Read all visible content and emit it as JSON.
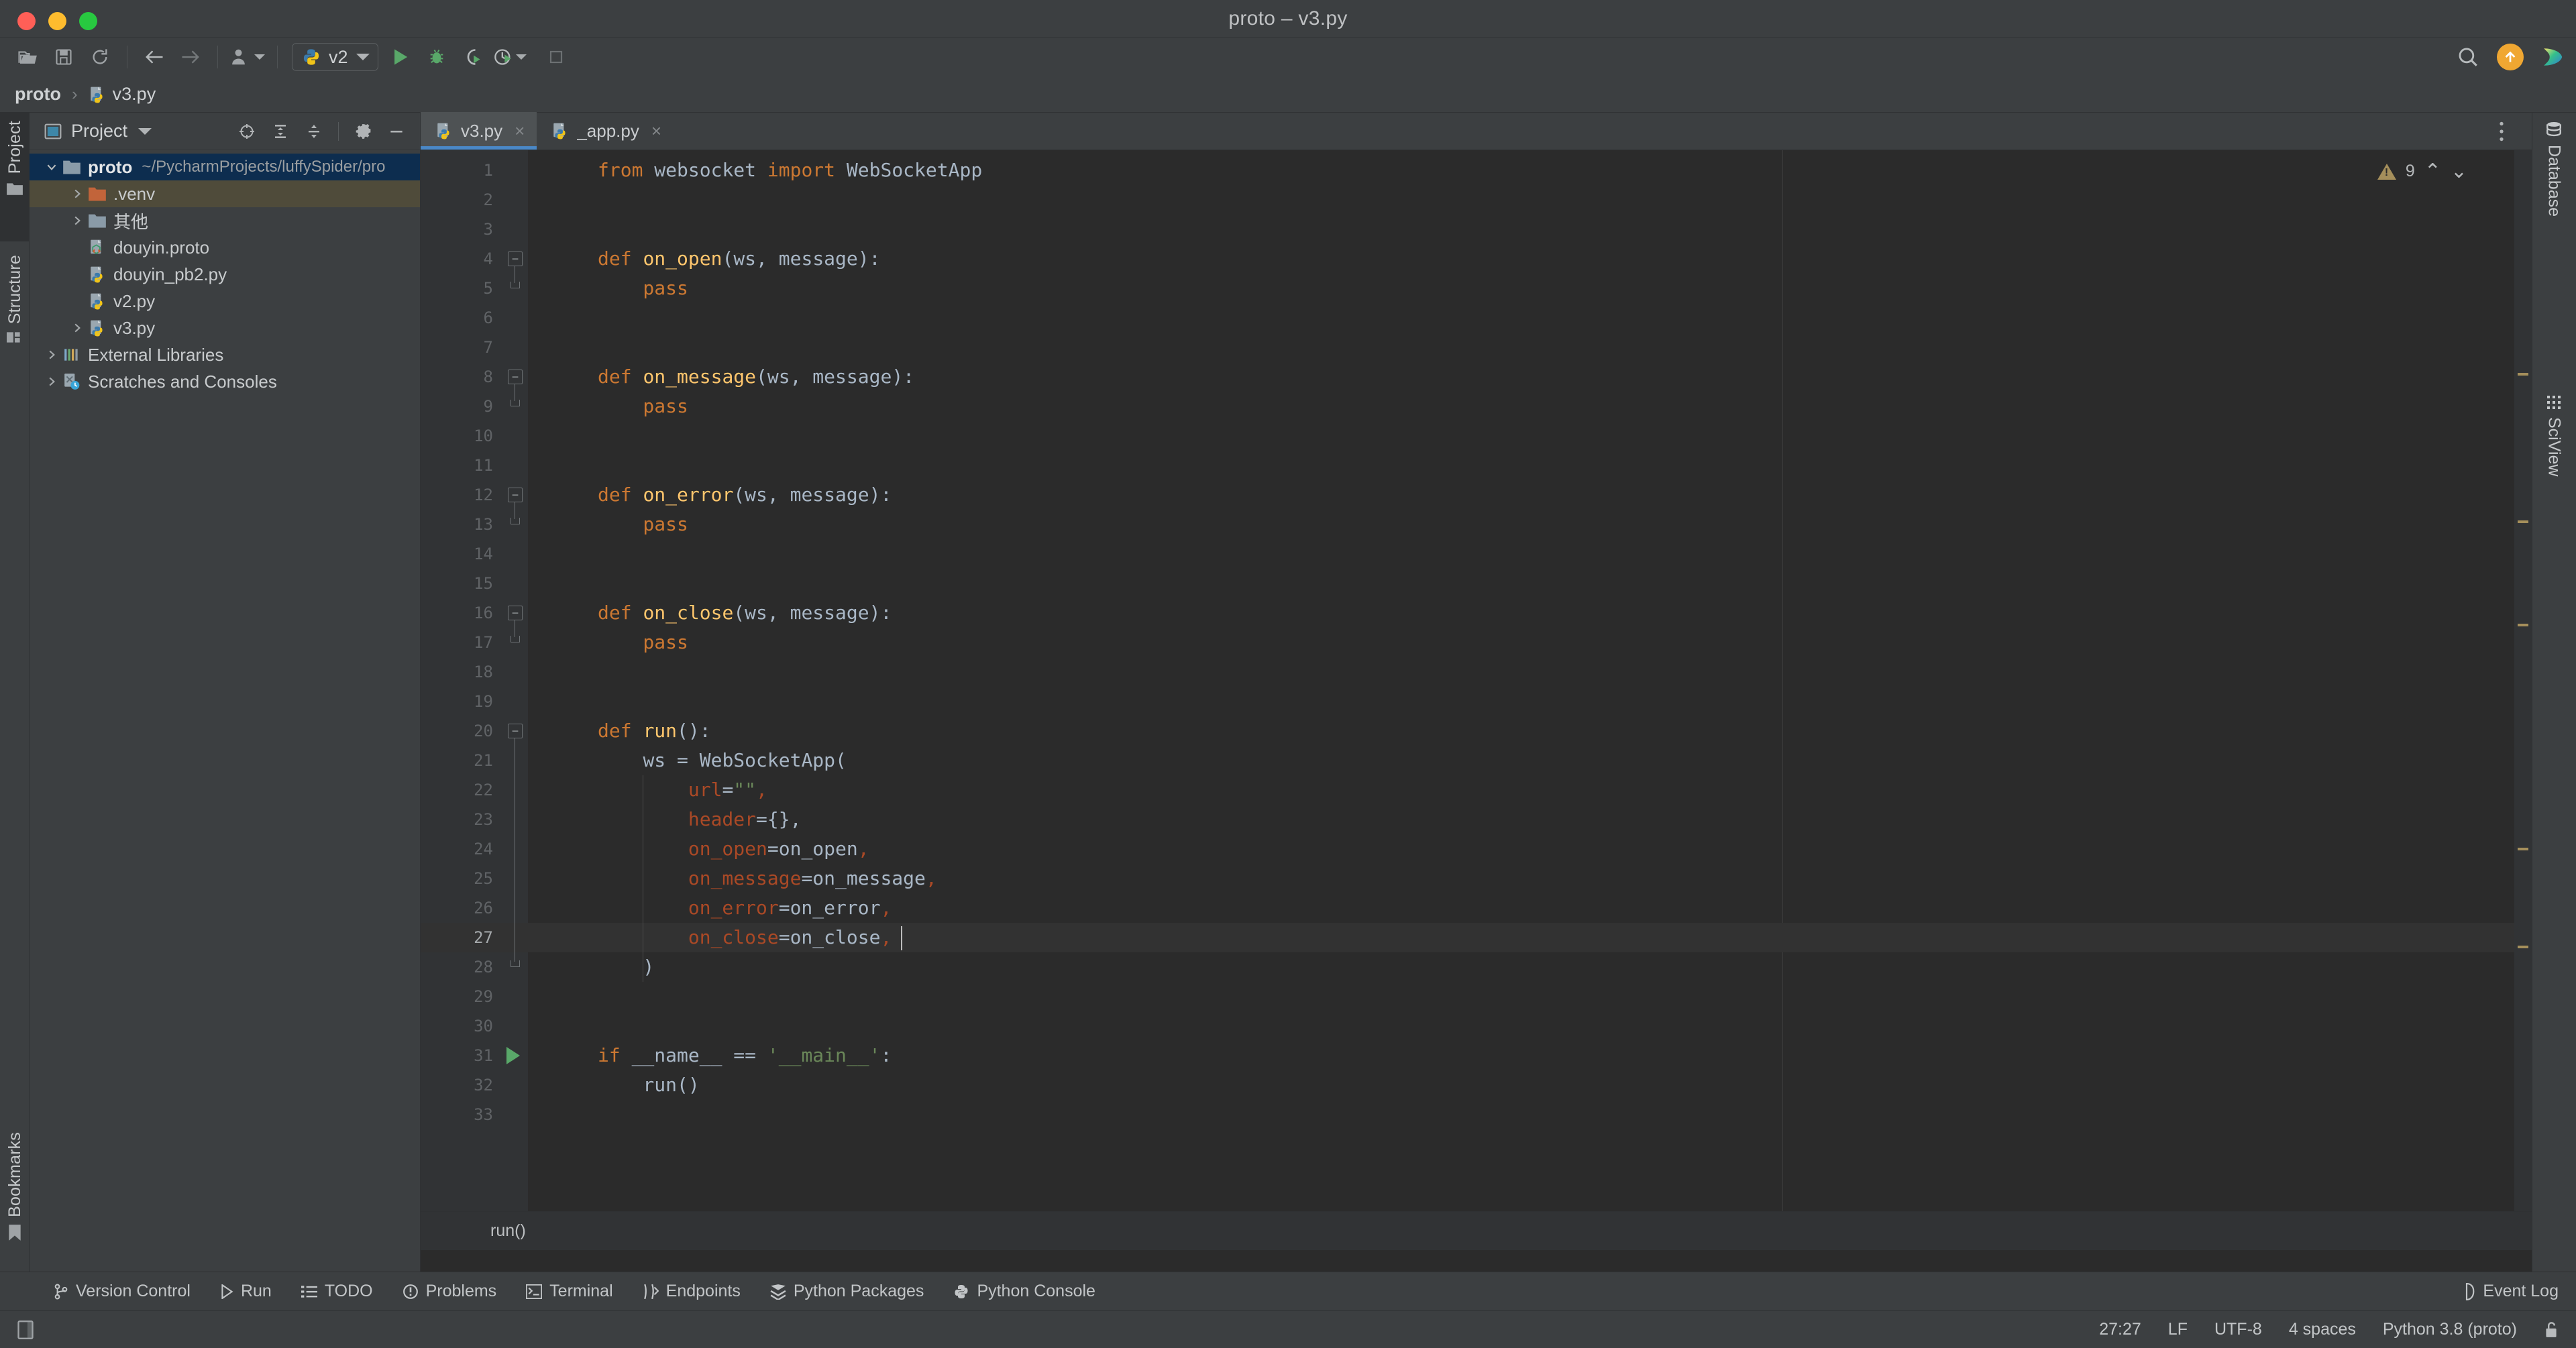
{
  "window": {
    "title": "proto – v3.py",
    "traffic_lights": [
      "close",
      "minimize",
      "zoom"
    ]
  },
  "toolbar": {
    "icons": [
      "open-folder-icon",
      "save-icon",
      "sync-icon",
      "back-arrow-icon",
      "forward-arrow-icon",
      "user-settings-icon"
    ],
    "run_config": {
      "label": "v2",
      "icon": "python-file-icon"
    },
    "actions": [
      "run-icon",
      "debug-icon",
      "run-coverage-icon",
      "profile-icon",
      "stop-icon"
    ],
    "right_icons": [
      "search-icon",
      "update-badge-icon",
      "ai-assistant-icon"
    ]
  },
  "navbar": {
    "project": "proto",
    "separator": "›",
    "file": "v3.py"
  },
  "left_strip": {
    "buttons": [
      {
        "label": "Project",
        "icon": "project-folder-icon",
        "active": true
      },
      {
        "label": "Structure",
        "icon": "structure-icon",
        "active": false
      },
      {
        "label": "Bookmarks",
        "icon": "bookmark-icon",
        "active": false
      }
    ]
  },
  "right_strip": {
    "buttons": [
      {
        "label": "Database",
        "icon": "database-icon"
      },
      {
        "label": "SciView",
        "icon": "sciview-grid-icon"
      }
    ]
  },
  "project_panel": {
    "title": "Project",
    "header_icons": [
      "select-opened-file-icon",
      "expand-all-icon",
      "collapse-all-icon",
      "gear-icon",
      "hide-icon",
      "more-options-icon"
    ],
    "tree": [
      {
        "label": "proto",
        "path": "~/PycharmProjects/luffySpider/pro",
        "icon": "folder-icon",
        "arrow": "down",
        "depth": 0,
        "state": "selected",
        "bold": true
      },
      {
        "label": ".venv",
        "icon": "venv-folder-icon",
        "arrow": "right",
        "depth": 1,
        "state": "hover"
      },
      {
        "label": "其他",
        "icon": "folder-icon",
        "arrow": "right",
        "depth": 1,
        "state": "normal"
      },
      {
        "label": "douyin.proto",
        "icon": "proto-file-icon",
        "arrow": "none",
        "depth": 1,
        "state": "normal"
      },
      {
        "label": "douyin_pb2.py",
        "icon": "python-file-icon",
        "arrow": "none",
        "depth": 1,
        "state": "normal"
      },
      {
        "label": "v2.py",
        "icon": "python-file-icon",
        "arrow": "none",
        "depth": 1,
        "state": "normal"
      },
      {
        "label": "v3.py",
        "icon": "python-file-icon",
        "arrow": "right",
        "depth": 1,
        "state": "normal"
      },
      {
        "label": "External Libraries",
        "icon": "libraries-icon",
        "arrow": "right",
        "depth": 0,
        "state": "normal"
      },
      {
        "label": "Scratches and Consoles",
        "icon": "scratches-icon",
        "arrow": "right",
        "depth": 0,
        "state": "normal"
      }
    ]
  },
  "editor": {
    "tabs": [
      {
        "label": "v3.py",
        "icon": "python-file-icon",
        "active": true,
        "close": "×"
      },
      {
        "label": "_app.py",
        "icon": "python-file-icon",
        "active": false,
        "close": "×"
      }
    ],
    "inspection": {
      "count": "9",
      "icon": "warning-triangle-icon",
      "up": "⌃",
      "down": "⌄"
    },
    "breadcrumb": "run()",
    "lines": [
      {
        "n": "1",
        "tokens": [
          {
            "t": "from ",
            "c": "kw"
          },
          {
            "t": "websocket ",
            "c": "id"
          },
          {
            "t": "import ",
            "c": "kw"
          },
          {
            "t": "WebSocketApp",
            "c": "id"
          }
        ]
      },
      {
        "n": "2",
        "tokens": []
      },
      {
        "n": "3",
        "tokens": []
      },
      {
        "n": "4",
        "tokens": [
          {
            "t": "def ",
            "c": "kw"
          },
          {
            "t": "on_open",
            "c": "fn"
          },
          {
            "t": "(",
            "c": "pm"
          },
          {
            "t": "ws, message",
            "c": "dflt"
          },
          {
            "t": "):",
            "c": "pm"
          }
        ]
      },
      {
        "n": "5",
        "tokens": [
          {
            "t": "    pass",
            "c": "kw"
          }
        ]
      },
      {
        "n": "6",
        "tokens": []
      },
      {
        "n": "7",
        "tokens": []
      },
      {
        "n": "8",
        "tokens": [
          {
            "t": "def ",
            "c": "kw"
          },
          {
            "t": "on_message",
            "c": "fn"
          },
          {
            "t": "(",
            "c": "pm"
          },
          {
            "t": "ws, message",
            "c": "dflt"
          },
          {
            "t": "):",
            "c": "pm"
          }
        ]
      },
      {
        "n": "9",
        "tokens": [
          {
            "t": "    pass",
            "c": "kw"
          }
        ]
      },
      {
        "n": "10",
        "tokens": []
      },
      {
        "n": "11",
        "tokens": []
      },
      {
        "n": "12",
        "tokens": [
          {
            "t": "def ",
            "c": "kw"
          },
          {
            "t": "on_error",
            "c": "fn"
          },
          {
            "t": "(",
            "c": "pm"
          },
          {
            "t": "ws, message",
            "c": "dflt"
          },
          {
            "t": "):",
            "c": "pm"
          }
        ]
      },
      {
        "n": "13",
        "tokens": [
          {
            "t": "    pass",
            "c": "kw"
          }
        ]
      },
      {
        "n": "14",
        "tokens": []
      },
      {
        "n": "15",
        "tokens": []
      },
      {
        "n": "16",
        "tokens": [
          {
            "t": "def ",
            "c": "kw"
          },
          {
            "t": "on_close",
            "c": "fn"
          },
          {
            "t": "(",
            "c": "pm"
          },
          {
            "t": "ws, message",
            "c": "dflt"
          },
          {
            "t": "):",
            "c": "pm"
          }
        ]
      },
      {
        "n": "17",
        "tokens": [
          {
            "t": "    pass",
            "c": "kw"
          }
        ]
      },
      {
        "n": "18",
        "tokens": []
      },
      {
        "n": "19",
        "tokens": []
      },
      {
        "n": "20",
        "tokens": [
          {
            "t": "def ",
            "c": "kw"
          },
          {
            "t": "run",
            "c": "fn"
          },
          {
            "t": "():",
            "c": "pm"
          }
        ]
      },
      {
        "n": "21",
        "tokens": [
          {
            "t": "    ",
            "c": "id"
          },
          {
            "t": "ws",
            "c": "dflt"
          },
          {
            "t": " = WebSocketApp(",
            "c": "id"
          }
        ]
      },
      {
        "n": "22",
        "tokens": [
          {
            "t": "        ",
            "c": "id"
          },
          {
            "t": "url",
            "c": "kwarg"
          },
          {
            "t": "=",
            "c": "id"
          },
          {
            "t": "\"\"",
            "c": "str"
          },
          {
            "t": ",",
            "c": "kwarg"
          }
        ]
      },
      {
        "n": "23",
        "tokens": [
          {
            "t": "        ",
            "c": "id"
          },
          {
            "t": "header",
            "c": "kwarg"
          },
          {
            "t": "={},",
            "c": "id"
          }
        ]
      },
      {
        "n": "24",
        "tokens": [
          {
            "t": "        ",
            "c": "id"
          },
          {
            "t": "on_open",
            "c": "kwarg"
          },
          {
            "t": "=on_open",
            "c": "id"
          },
          {
            "t": ",",
            "c": "kwarg"
          }
        ]
      },
      {
        "n": "25",
        "tokens": [
          {
            "t": "        ",
            "c": "id"
          },
          {
            "t": "on_message",
            "c": "kwarg"
          },
          {
            "t": "=on_message",
            "c": "id"
          },
          {
            "t": ",",
            "c": "kwarg"
          }
        ]
      },
      {
        "n": "26",
        "tokens": [
          {
            "t": "        ",
            "c": "id"
          },
          {
            "t": "on_error",
            "c": "kwarg"
          },
          {
            "t": "=on_error",
            "c": "id"
          },
          {
            "t": ",",
            "c": "kwarg"
          }
        ]
      },
      {
        "n": "27",
        "tokens": [
          {
            "t": "        ",
            "c": "id"
          },
          {
            "t": "on_close",
            "c": "kwarg"
          },
          {
            "t": "=on_close",
            "c": "id"
          },
          {
            "t": ",",
            "c": "kwarg"
          }
        ],
        "highlight": true
      },
      {
        "n": "28",
        "tokens": [
          {
            "t": "    )",
            "c": "id"
          }
        ]
      },
      {
        "n": "29",
        "tokens": []
      },
      {
        "n": "30",
        "tokens": []
      },
      {
        "n": "31",
        "tokens": [
          {
            "t": "if ",
            "c": "kw"
          },
          {
            "t": "__name__ == ",
            "c": "id"
          },
          {
            "t": "'__main__'",
            "c": "str"
          },
          {
            "t": ":",
            "c": "id"
          }
        ],
        "runmarker": true
      },
      {
        "n": "32",
        "tokens": [
          {
            "t": "    run()",
            "c": "id"
          }
        ]
      },
      {
        "n": "33",
        "tokens": []
      }
    ]
  },
  "bottom_bar": {
    "items": [
      {
        "label": "Version Control",
        "icon": "branch-icon"
      },
      {
        "label": "Run",
        "icon": "run-triangle-icon"
      },
      {
        "label": "TODO",
        "icon": "todo-list-icon"
      },
      {
        "label": "Problems",
        "icon": "problems-icon"
      },
      {
        "label": "Terminal",
        "icon": "terminal-icon"
      },
      {
        "label": "Endpoints",
        "icon": "endpoints-icon"
      },
      {
        "label": "Python Packages",
        "icon": "packages-icon"
      },
      {
        "label": "Python Console",
        "icon": "python-console-icon"
      }
    ],
    "event_log": {
      "label": "Event Log",
      "icon": "event-log-icon"
    }
  },
  "status_bar": {
    "left_icon": "ide-layout-icon",
    "caret_position": "27:27",
    "line_separator": "LF",
    "encoding": "UTF-8",
    "indent": "4 spaces",
    "interpreter": "Python 3.8 (proto)",
    "lock_icon": "unlocked-padlock-icon"
  },
  "colors": {
    "bg": "#3c3f41",
    "editor_bg": "#2b2b2b",
    "gutter_bg": "#313335",
    "accent_blue": "#4a88c7",
    "selection": "#0d2d4f",
    "hover": "#4f4b3a",
    "keyword": "#cc7832",
    "function": "#ffc66d",
    "string": "#6a8759",
    "kwarg": "#aa4926",
    "identifier": "#a9b7c6",
    "green_run": "#59a869",
    "warn": "#a58f5b",
    "orange_badge": "#f0a732"
  }
}
